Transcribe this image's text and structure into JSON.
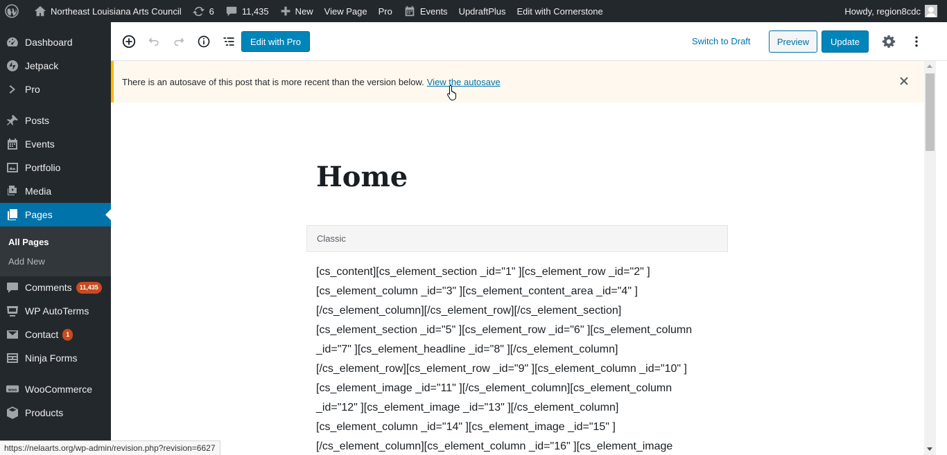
{
  "adminbar": {
    "site_name": "Northeast Louisiana Arts Council",
    "updates_count": "6",
    "comments_count": "11,435",
    "new_label": "New",
    "view_page_label": "View Page",
    "pro_label": "Pro",
    "events_label": "Events",
    "updraft_label": "UpdraftPlus",
    "cornerstone_label": "Edit with Cornerstone",
    "howdy": "Howdy, region8cdc"
  },
  "sidebar": {
    "dashboard": "Dashboard",
    "jetpack": "Jetpack",
    "pro": "Pro",
    "posts": "Posts",
    "events": "Events",
    "portfolio": "Portfolio",
    "media": "Media",
    "pages": "Pages",
    "all_pages": "All Pages",
    "add_new": "Add New",
    "comments": "Comments",
    "comments_badge": "11,435",
    "autoterms": "WP AutoTerms",
    "contact": "Contact",
    "contact_badge": "1",
    "ninja_forms": "Ninja Forms",
    "woocommerce": "WooCommerce",
    "products": "Products"
  },
  "toolbar": {
    "edit_with_pro": "Edit with Pro",
    "switch_to_draft": "Switch to Draft",
    "preview": "Preview",
    "update": "Update"
  },
  "notice": {
    "text": "There is an autosave of this post that is more recent than the version below.",
    "link": "View the autosave"
  },
  "post": {
    "title": "Home",
    "classic_label": "Classic",
    "content_lines": [
      "[cs_content][cs_element_section _id=\"1\" ][cs_element_row _id=\"2\" ]",
      "[cs_element_column _id=\"3\" ][cs_element_content_area _id=\"4\" ]",
      "[/cs_element_column][/cs_element_row][/cs_element_section]",
      "[cs_element_section _id=\"5\" ][cs_element_row _id=\"6\" ][cs_element_column",
      "_id=\"7\" ][cs_element_headline _id=\"8\" ][/cs_element_column]",
      "[/cs_element_row][cs_element_row _id=\"9\" ][cs_element_column _id=\"10\" ]",
      "[cs_element_image _id=\"11\" ][/cs_element_column][cs_element_column",
      "_id=\"12\" ][cs_element_image _id=\"13\" ][/cs_element_column]",
      "[cs_element_column _id=\"14\" ][cs_element_image _id=\"15\" ]",
      "[/cs_element_column][cs_element_column _id=\"16\" ][cs_element_image"
    ]
  },
  "statusbar": {
    "url": "https://nelaarts.org/wp-admin/revision.php?revision=6627"
  },
  "colors": {
    "adminbar_bg": "#23282d",
    "accent": "#0073aa",
    "badge": "#ca4a1f",
    "notice_border": "#ffb900"
  }
}
